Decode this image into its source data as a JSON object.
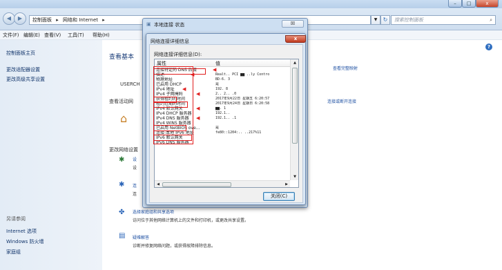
{
  "window": {
    "minimize_glyph": "–",
    "maximize_glyph": "□",
    "close_glyph": "x"
  },
  "address_bar": {
    "crumbs": [
      "控制面板",
      "▸",
      "网络和 Internet",
      "▸"
    ],
    "search_placeholder": "搜索控制面板"
  },
  "menu": [
    "文件(F)",
    "编辑(E)",
    "查看(V)",
    "工具(T)",
    "帮助(H)"
  ],
  "sidebar": {
    "top_links": [
      "控制面板主页",
      "更改适配器设置",
      "更改高级共享设置"
    ],
    "see_also_title": "另请参阅",
    "bottom_links": [
      "Internet 选项",
      "Windows 防火墙",
      "家庭组"
    ]
  },
  "content": {
    "heading": "查看基本",
    "user_label": "USERCH",
    "active_networks": "查看活动网",
    "change_settings": "更改网络设置",
    "view_full_map": "查看完整映射",
    "connect_disconnect": "连接或断开连接",
    "item1_link": "设",
    "item1_desc": "设",
    "item2_link": "连",
    "item2_desc": "连",
    "item3_link": "选择家庭组和共享选项",
    "item3_desc": "访问位于其他网络计算机上的文件和打印机，或更改共享设置。",
    "item4_link": "疑难解答",
    "item4_desc": "诊断并修复网络问题，或获得故障排除信息。"
  },
  "status_dialog": {
    "title": "本地连接 状态",
    "close_glyph": "☒"
  },
  "details_dialog": {
    "title": "网络连接详细信息",
    "close_glyph": "x",
    "list_label": "网络连接详细信息(D):",
    "col_property": "属性",
    "col_value": "值",
    "rows": [
      {
        "k": "连接特定的 DNS 后缀",
        "v": ""
      },
      {
        "k": "描述",
        "v": "Realt.. PCI ▆▆ ..ly Contro"
      },
      {
        "k": "物理地址",
        "v": "BD-6.            3"
      },
      {
        "k": "已启用 DHCP",
        "v": "是"
      },
      {
        "k": "IPv4 地址",
        "v": "192.          8"
      },
      {
        "k": "IPv4 子网掩码",
        "v": "2..  2..  .0"
      },
      {
        "k": "获得租约的时间",
        "v": "2017年9月22日 星期五 6:20:57"
      },
      {
        "k": "租约过期的时间",
        "v": "2017年9月24日 星期日 6:20:58"
      },
      {
        "k": "IPv4 默认网关",
        "v": "▆▆.      1"
      },
      {
        "k": "IPv4 DHCP 服务器",
        "v": "192.1.."
      },
      {
        "k": "IPv4 DNS 服务器",
        "v": "192.1..   .1"
      },
      {
        "k": "IPv4 WINS 服务器",
        "v": ""
      },
      {
        "k": "已启用 NetBIOS ove...",
        "v": "是"
      },
      {
        "k": "连接-本地 IPv6 地址",
        "v": "fe80::1204:..   ..217%11"
      },
      {
        "k": "IPv6 默认网关",
        "v": ""
      },
      {
        "k": "IPv6 DNS 服务器",
        "v": ""
      }
    ],
    "close_button": "关闭(C)"
  },
  "icons": {
    "back": "◀",
    "forward": "▶",
    "dropdown": "▼",
    "refresh": "↻",
    "search": "⌕",
    "help": "?",
    "network_adapter": "▣",
    "arrow_left": "◀",
    "scroll_up": "▲",
    "scroll_down": "▼",
    "scroll_left": "◀",
    "scroll_right": "▶"
  },
  "accent_colors": {
    "callout_red": "#e01c1c",
    "link_blue": "#1e50a2"
  }
}
